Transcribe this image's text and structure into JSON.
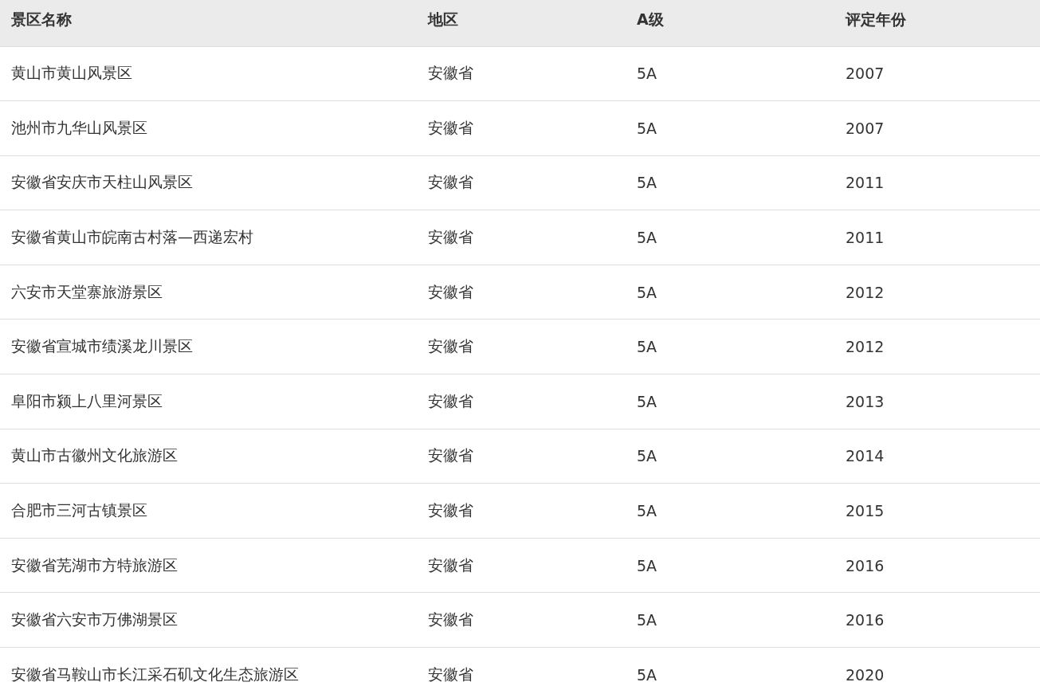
{
  "table": {
    "columns": [
      "景区名称",
      "地区",
      "A级",
      "评定年份"
    ],
    "rows": [
      [
        "黄山市黄山风景区",
        "安徽省",
        "5A",
        "2007"
      ],
      [
        "池州市九华山风景区",
        "安徽省",
        "5A",
        "2007"
      ],
      [
        "安徽省安庆市天柱山风景区",
        "安徽省",
        "5A",
        "2011"
      ],
      [
        "安徽省黄山市皖南古村落—西递宏村",
        "安徽省",
        "5A",
        "2011"
      ],
      [
        "六安市天堂寨旅游景区",
        "安徽省",
        "5A",
        "2012"
      ],
      [
        "安徽省宣城市绩溪龙川景区",
        "安徽省",
        "5A",
        "2012"
      ],
      [
        "阜阳市颍上八里河景区",
        "安徽省",
        "5A",
        "2013"
      ],
      [
        "黄山市古徽州文化旅游区",
        "安徽省",
        "5A",
        "2014"
      ],
      [
        "合肥市三河古镇景区",
        "安徽省",
        "5A",
        "2015"
      ],
      [
        "安徽省芜湖市方特旅游区",
        "安徽省",
        "5A",
        "2016"
      ],
      [
        "安徽省六安市万佛湖景区",
        "安徽省",
        "5A",
        "2016"
      ],
      [
        "安徽省马鞍山市长江采石矶文化生态旅游区",
        "安徽省",
        "5A",
        "2020"
      ]
    ]
  }
}
